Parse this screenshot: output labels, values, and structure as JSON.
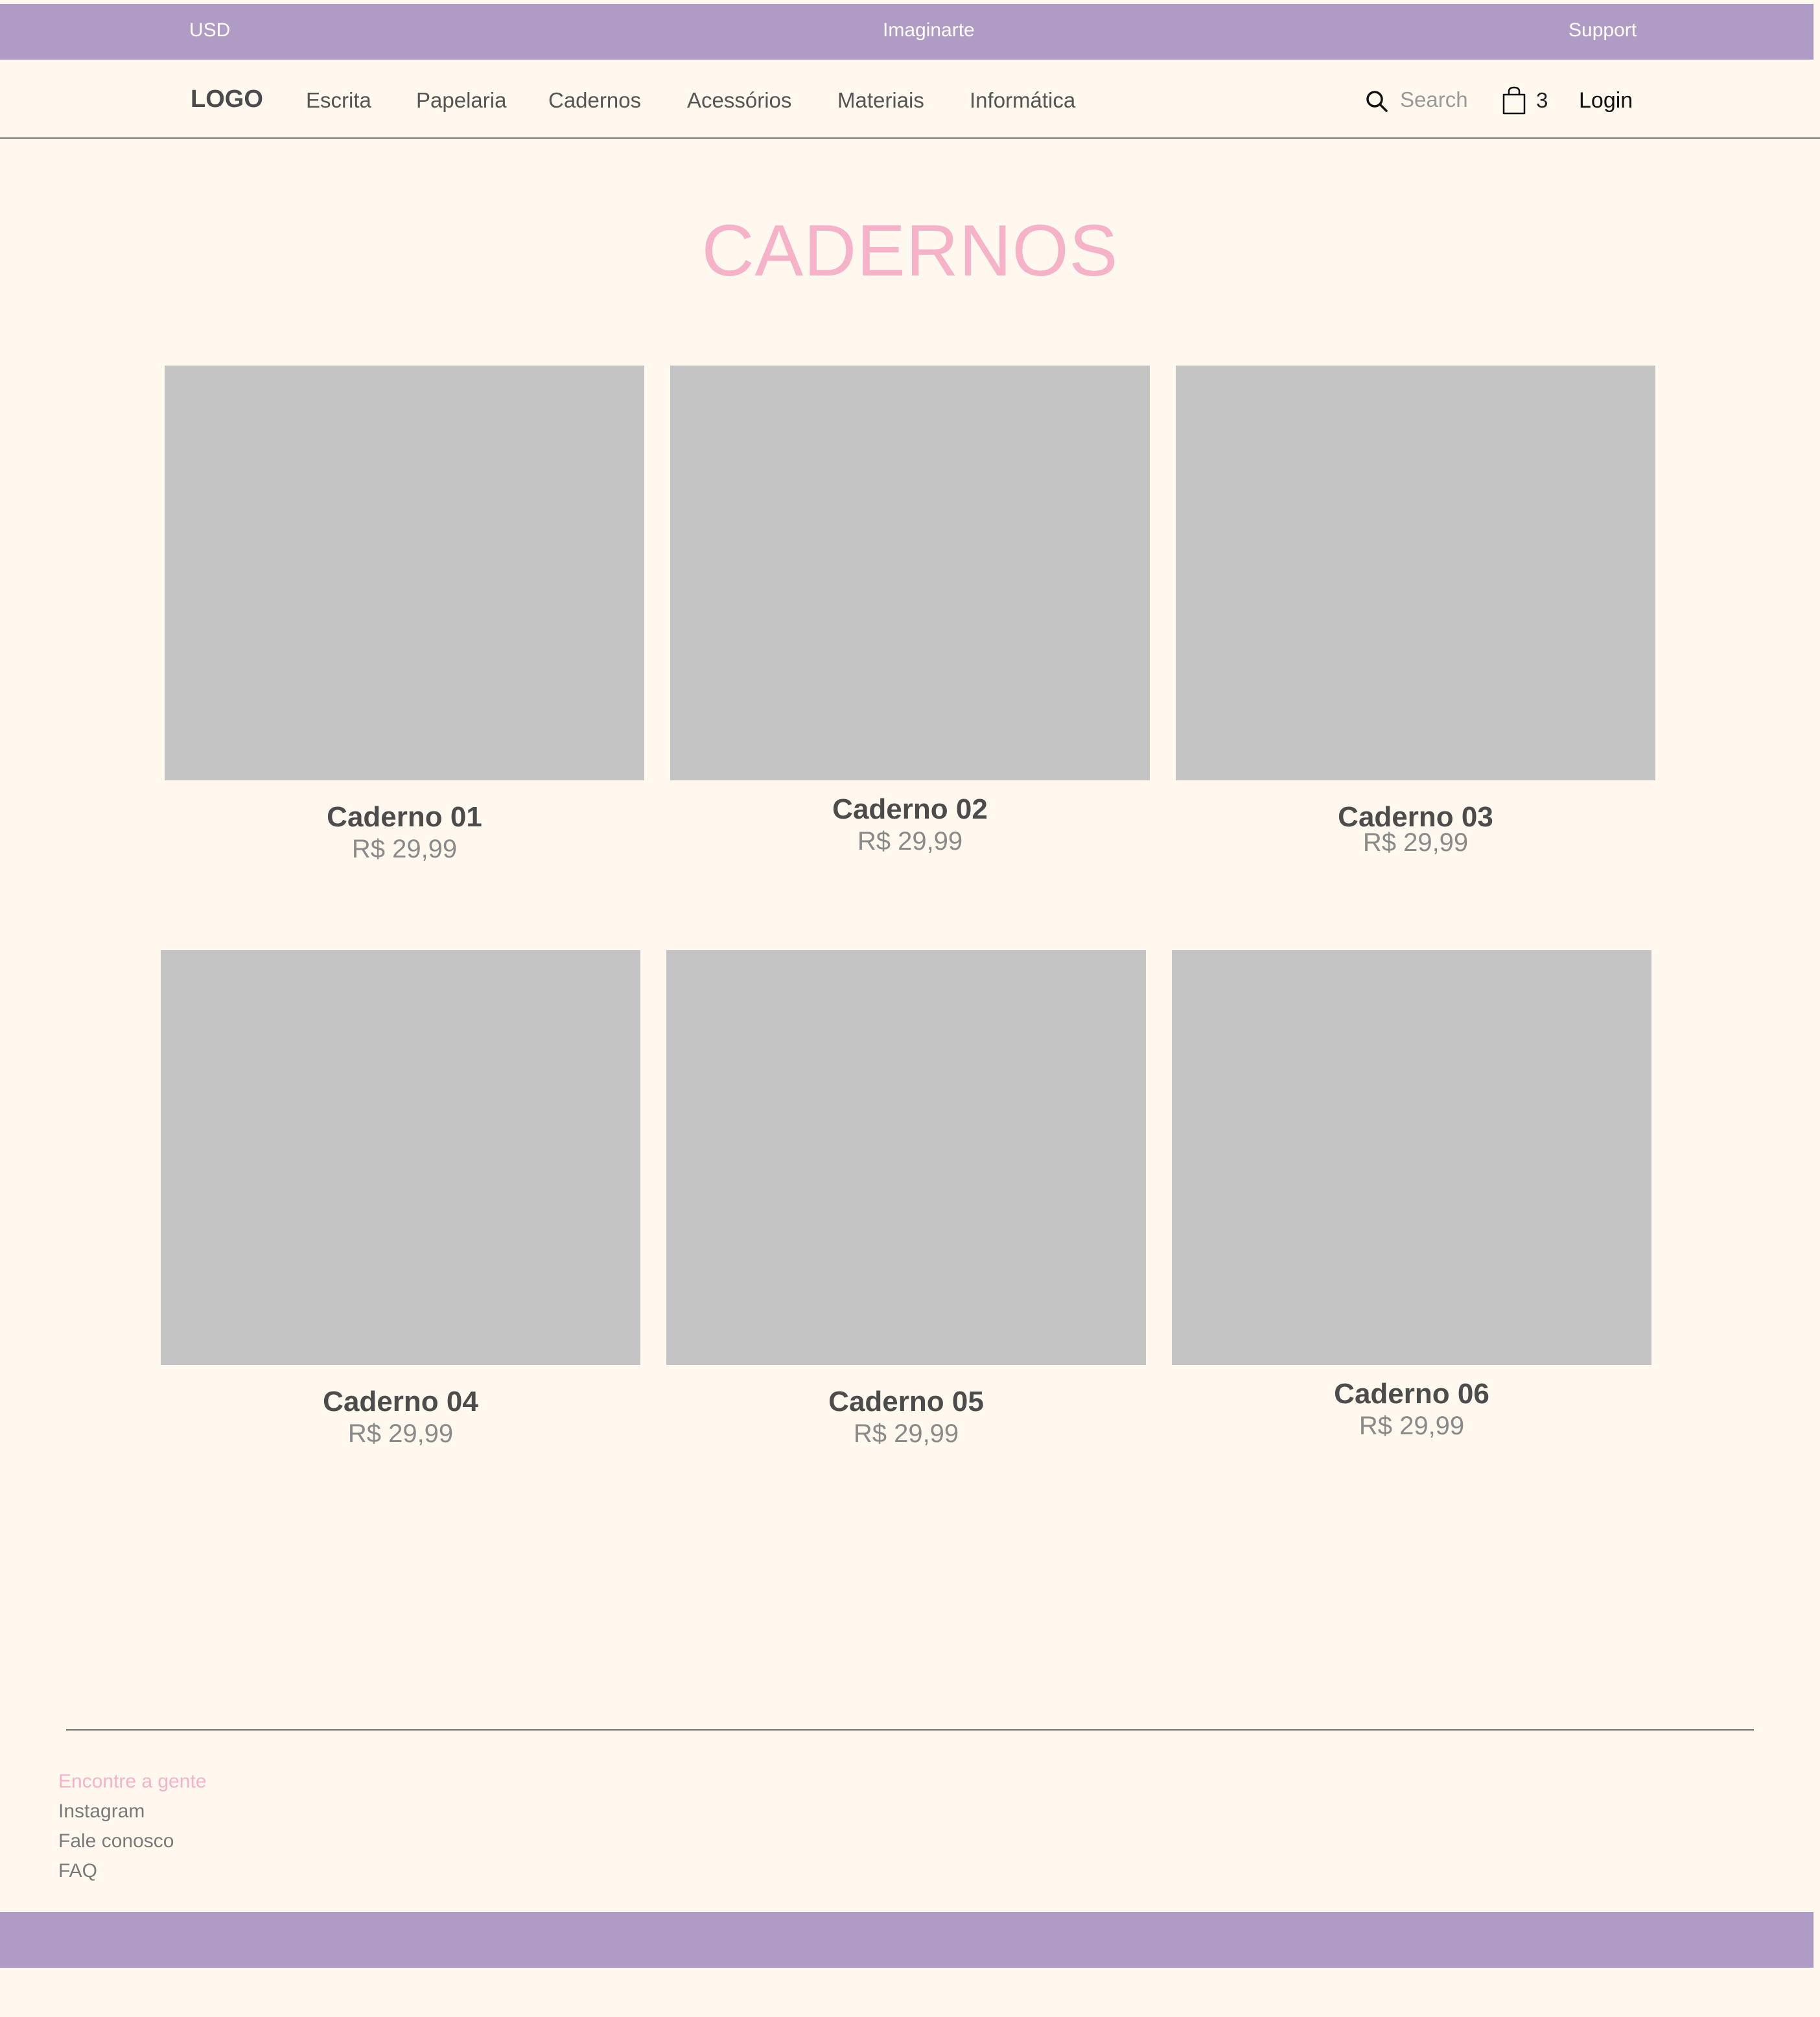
{
  "topbar": {
    "currency": "USD",
    "brand": "Imaginarte",
    "support": "Support"
  },
  "nav": {
    "logo": "LOGO",
    "items": [
      {
        "label": "Escrita"
      },
      {
        "label": "Papelaria"
      },
      {
        "label": "Cadernos"
      },
      {
        "label": "Acessórios"
      },
      {
        "label": "Materiais"
      },
      {
        "label": "Informática"
      }
    ],
    "search_placeholder": "Search",
    "cart_count": "3",
    "login": "Login"
  },
  "page": {
    "title": "CADERNOS"
  },
  "products": [
    {
      "name": "Caderno 01",
      "price": "R$ 29,99"
    },
    {
      "name": "Caderno 02",
      "price": "R$ 29,99"
    },
    {
      "name": "Caderno 03",
      "price": "R$ 29,99"
    },
    {
      "name": "Caderno 04",
      "price": "R$ 29,99"
    },
    {
      "name": "Caderno 05",
      "price": "R$ 29,99"
    },
    {
      "name": "Caderno 06",
      "price": "R$ 29,99"
    }
  ],
  "footer": {
    "heading": "Encontre a gente",
    "links": [
      {
        "label": "Instagram"
      },
      {
        "label": "Fale conosco"
      },
      {
        "label": "FAQ"
      }
    ]
  },
  "colors": {
    "accent_purple": "#af9bc3",
    "title_pink": "#f6b2c8",
    "background": "#fef8ef",
    "placeholder_gray": "#c4c4c4"
  },
  "icons": {
    "search": "search-icon",
    "cart": "shopping-bag-icon"
  }
}
